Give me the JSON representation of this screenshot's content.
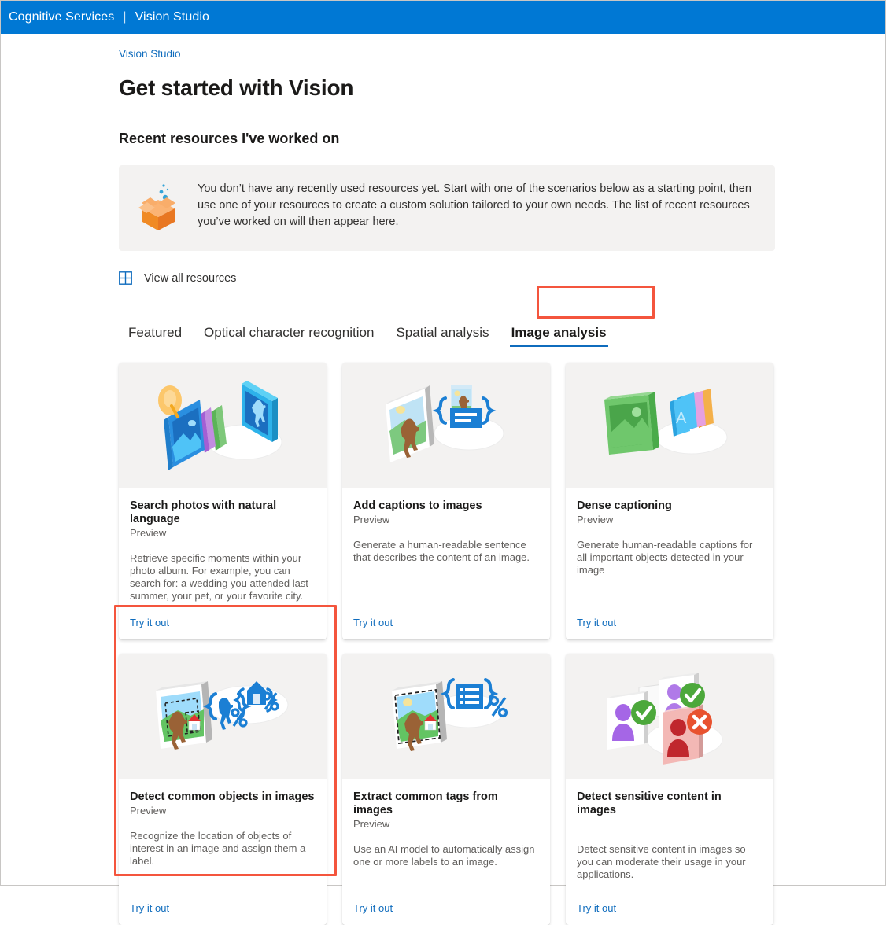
{
  "topbar": {
    "brand": "Cognitive Services",
    "divider": "|",
    "app": "Vision Studio"
  },
  "breadcrumb": "Vision Studio",
  "page_title": "Get started with Vision",
  "section_title": "Recent resources I've worked on",
  "banner": {
    "icon": "open-box-icon",
    "text": "You don’t have any recently used resources yet. Start with one of the scenarios below as a starting point, then use one of your resources to create a custom solution tailored to your own needs. The list of recent resources you’ve worked on will then appear here."
  },
  "view_all_resources": {
    "icon": "grid-icon",
    "label": "View all resources"
  },
  "tabs": [
    {
      "label": "Featured",
      "selected": false
    },
    {
      "label": "Optical character recognition",
      "selected": false
    },
    {
      "label": "Spatial analysis",
      "selected": false
    },
    {
      "label": "Image analysis",
      "selected": true
    }
  ],
  "cards": [
    {
      "illustration": "search-photos-illustration",
      "title": "Search photos with natural language",
      "preview": "Preview",
      "description": "Retrieve specific moments within your photo album. For example, you can search for: a wedding you attended last summer, your pet, or your favorite city.",
      "link": "Try it out"
    },
    {
      "illustration": "add-captions-illustration",
      "title": "Add captions to images",
      "preview": "Preview",
      "description": "Generate a human-readable sentence that describes the content of an image.",
      "link": "Try it out"
    },
    {
      "illustration": "dense-captioning-illustration",
      "title": "Dense captioning",
      "preview": "Preview",
      "description": "Generate human-readable captions for all important objects detected in your image",
      "link": "Try it out"
    },
    {
      "illustration": "detect-objects-illustration",
      "title": "Detect common objects in images",
      "preview": "Preview",
      "description": "Recognize the location of objects of interest in an image and assign them a label.",
      "link": "Try it out"
    },
    {
      "illustration": "extract-tags-illustration",
      "title": "Extract common tags from images",
      "preview": "Preview",
      "description": "Use an AI model to automatically assign one or more labels to an image.",
      "link": "Try it out"
    },
    {
      "illustration": "detect-sensitive-illustration",
      "title": "Detect sensitive content in images",
      "preview": "",
      "description": "Detect sensitive content in images so you can moderate their usage in your applications.",
      "link": "Try it out"
    }
  ],
  "colors": {
    "topbar_blue": "#0078d4",
    "link_blue": "#0f6cbd",
    "annotation_red": "#f4553d",
    "banner_gray": "#f3f2f1",
    "illustration_gray": "#f3f2f1"
  },
  "annotations": [
    {
      "name": "highlight-image-analysis-tab"
    },
    {
      "name": "highlight-detect-objects-card"
    }
  ]
}
